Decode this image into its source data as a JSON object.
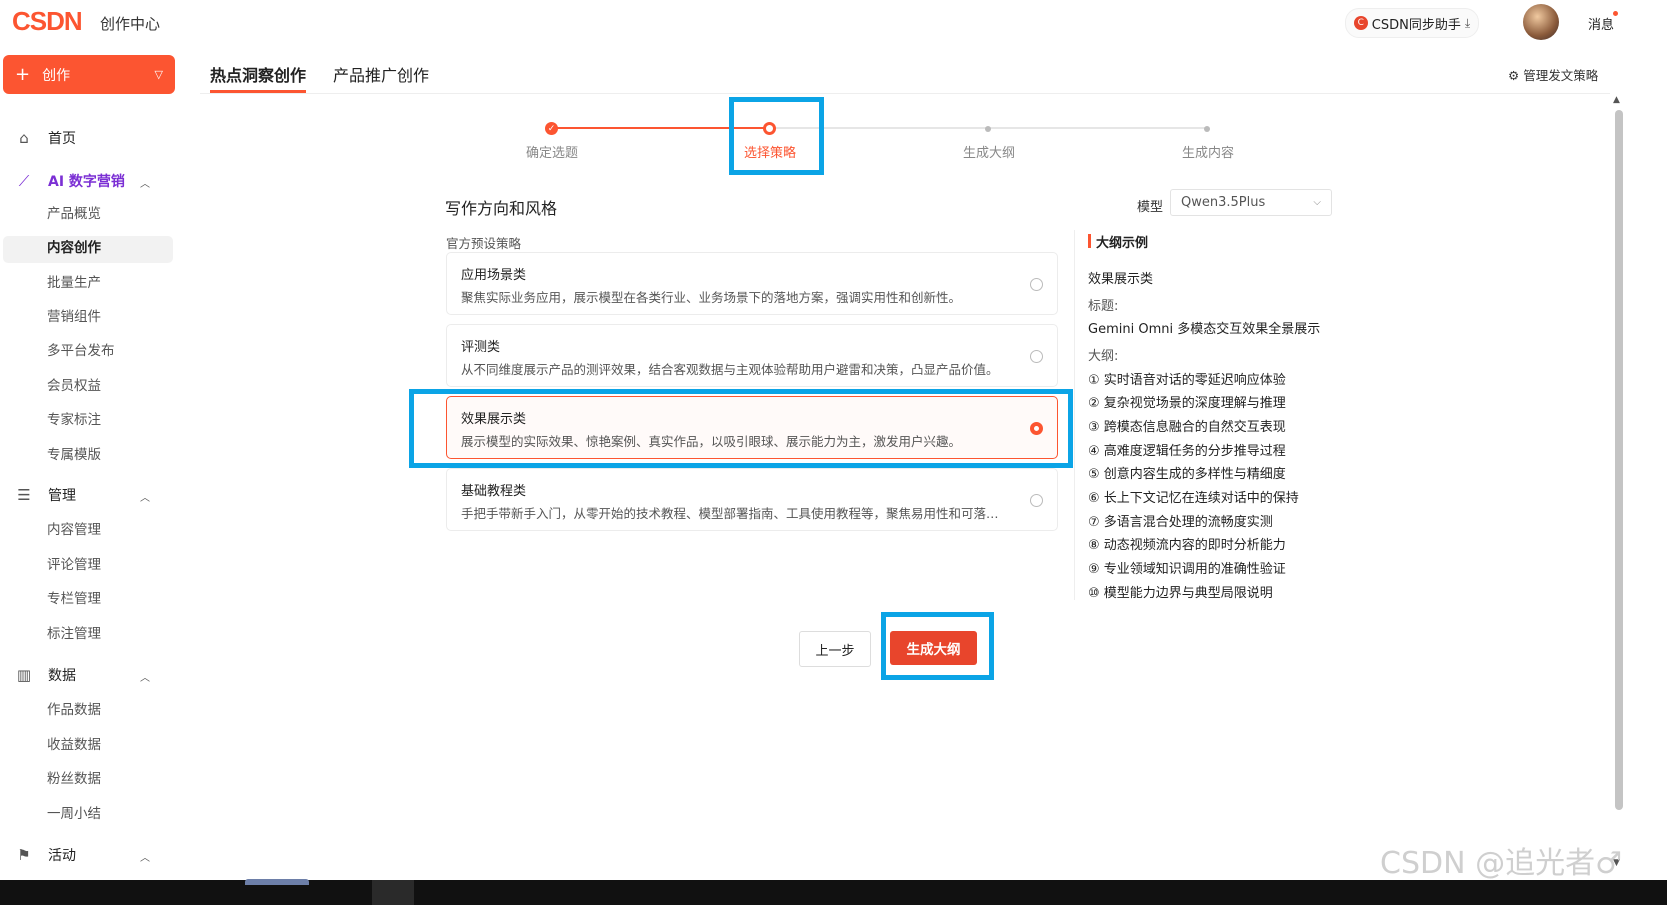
{
  "header": {
    "logo": "CSDN",
    "title": "创作中心",
    "sync_label": "CSDN同步助手",
    "sync_badge": "C",
    "message_label": "消息"
  },
  "sidebar": {
    "create_label": "创作",
    "home": "首页",
    "ai_group": "AI 数字营销",
    "ai_items": [
      "产品概览",
      "内容创作",
      "批量生产",
      "营销组件",
      "多平台发布",
      "会员权益",
      "专家标注",
      "专属模版"
    ],
    "manage_group": "管理",
    "manage_items": [
      "内容管理",
      "评论管理",
      "专栏管理",
      "标注管理"
    ],
    "data_group": "数据",
    "data_items": [
      "作品数据",
      "收益数据",
      "粉丝数据",
      "一周小结"
    ],
    "activity_group": "活动"
  },
  "tabs": [
    "热点洞察创作",
    "产品推广创作"
  ],
  "manage_strategy": "管理发文策略",
  "steps": [
    "确定选题",
    "选择策略",
    "生成大纲",
    "生成内容"
  ],
  "section_title": "写作方向和风格",
  "model": {
    "label": "模型",
    "value": "Qwen3.5Plus"
  },
  "preset_label": "官方预设策略",
  "strategies": [
    {
      "title": "应用场景类",
      "desc": "聚焦实际业务应用，展示模型在各类行业、业务场景下的落地方案，强调实用性和创新性。"
    },
    {
      "title": "评测类",
      "desc": "从不同维度展示产品的测评效果，结合客观数据与主观体验帮助用户避雷和决策，凸显产品价值。"
    },
    {
      "title": "效果展示类",
      "desc": "展示模型的实际效果、惊艳案例、真实作品，以吸引眼球、展示能力为主，激发用户兴趣。"
    },
    {
      "title": "基础教程类",
      "desc": "手把手带新手入门，从零开始的技术教程、模型部署指南、工具使用教程等，聚焦易用性和可落地..."
    }
  ],
  "outline": {
    "heading": "大纲示例",
    "category": "效果展示类",
    "title_label": "标题:",
    "title_value": "Gemini Omni 多模态交互效果全景展示",
    "outline_label": "大纲:",
    "items": [
      "① 实时语音对话的零延迟响应体验",
      "② 复杂视觉场景的深度理解与推理",
      "③ 跨模态信息融合的自然交互表现",
      "④ 高难度逻辑任务的分步推导过程",
      "⑤ 创意内容生成的多样性与精细度",
      "⑥ 长上下文记忆在连续对话中的保持",
      "⑦ 多语言混合处理的流畅度实测",
      "⑧ 动态视频流内容的即时分析能力",
      "⑨ 专业领域知识调用的准确性验证",
      "⑩ 模型能力边界与典型局限说明"
    ]
  },
  "buttons": {
    "prev": "上一步",
    "generate": "生成大纲"
  },
  "watermark": "CSDN @追光者♂",
  "colors": {
    "brand": "#fc5531",
    "highlight": "#0ba4e6",
    "ai_purple": "#7b2fd4"
  }
}
